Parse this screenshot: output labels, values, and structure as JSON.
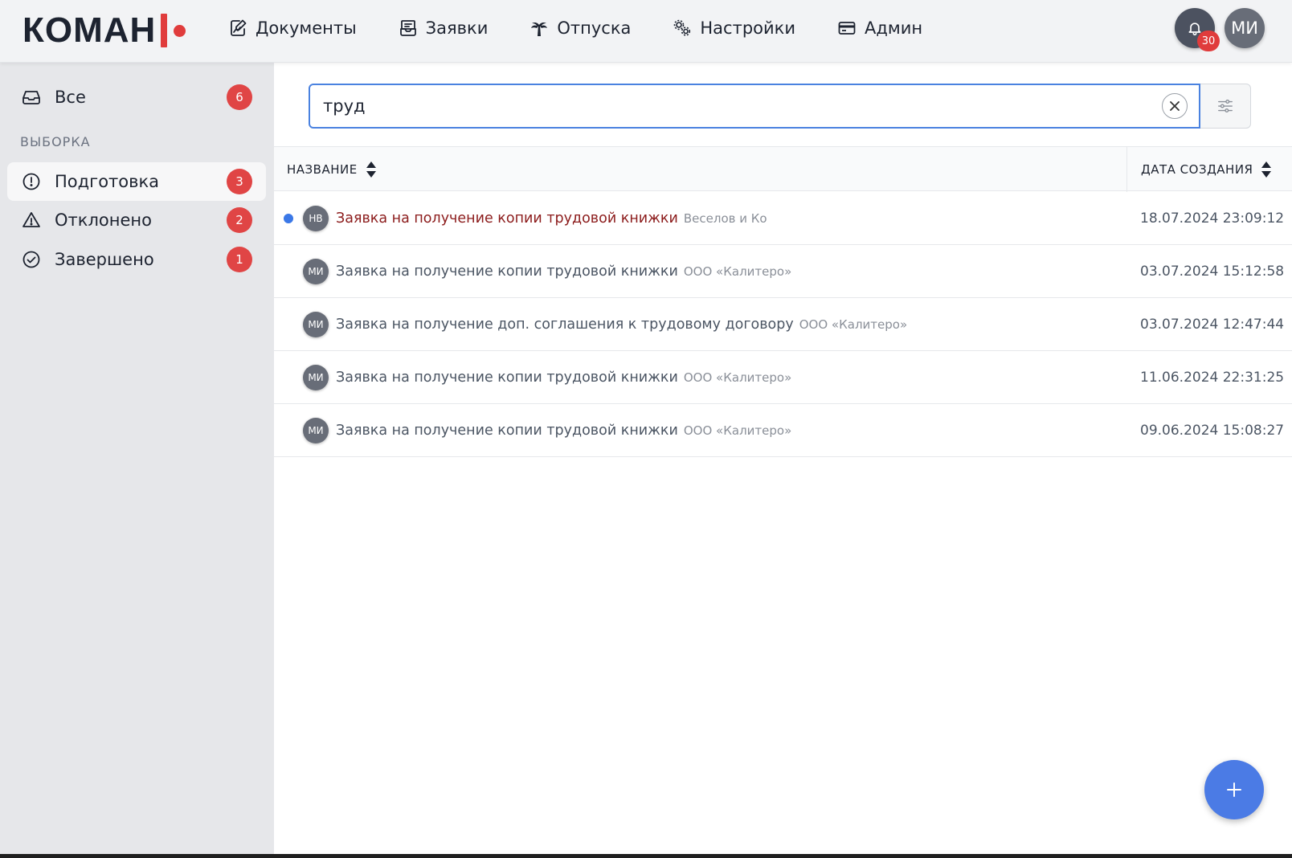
{
  "logo": {
    "text": "КОМАН"
  },
  "nav": [
    {
      "id": "documents",
      "label": "Документы",
      "icon": "document-edit-icon"
    },
    {
      "id": "requests",
      "label": "Заявки",
      "icon": "inbox-icon"
    },
    {
      "id": "vacations",
      "label": "Отпуска",
      "icon": "palm-tree-icon"
    },
    {
      "id": "settings",
      "label": "Настройки",
      "icon": "gears-icon"
    },
    {
      "id": "admin",
      "label": "Админ",
      "icon": "card-icon"
    }
  ],
  "header": {
    "notifications_count": "30",
    "user_initials": "МИ"
  },
  "sidebar": {
    "all": {
      "label": "Все",
      "count": "6"
    },
    "section_title": "ВЫБОРКА",
    "items": [
      {
        "label": "Подготовка",
        "count": "3",
        "icon": "exclamation-circle-icon"
      },
      {
        "label": "Отклонено",
        "count": "2",
        "icon": "warning-triangle-icon"
      },
      {
        "label": "Завершено",
        "count": "1",
        "icon": "check-circle-icon"
      }
    ]
  },
  "search": {
    "value": "труд",
    "placeholder": ""
  },
  "table": {
    "col_name": "НАЗВАНИЕ",
    "col_date": "ДАТА СОЗДАНИЯ",
    "rows": [
      {
        "initials": "НВ",
        "title": "Заявка на получение копии трудовой книжки",
        "org": "Веселов и Ко",
        "date": "18.07.2024 23:09:12",
        "unread": true
      },
      {
        "initials": "МИ",
        "title": "Заявка на получение копии трудовой книжки",
        "org": "ООО «Калитеро»",
        "date": "03.07.2024 15:12:58",
        "unread": false
      },
      {
        "initials": "МИ",
        "title": "Заявка на получение доп. соглашения к трудовому договору",
        "org": "ООО «Калитеро»",
        "date": "03.07.2024 12:47:44",
        "unread": false
      },
      {
        "initials": "МИ",
        "title": "Заявка на получение копии трудовой книжки",
        "org": "ООО «Калитеро»",
        "date": "11.06.2024 22:31:25",
        "unread": false
      },
      {
        "initials": "МИ",
        "title": "Заявка на получение копии трудовой книжки",
        "org": "ООО «Калитеро»",
        "date": "09.06.2024 15:08:27",
        "unread": false
      }
    ]
  },
  "colors": {
    "accent": "#4b7be5",
    "brand_red": "#e03c3c",
    "badge_red": "#e04545",
    "unread_title": "#8c1c1c",
    "unread_dot": "#3b78e7"
  }
}
